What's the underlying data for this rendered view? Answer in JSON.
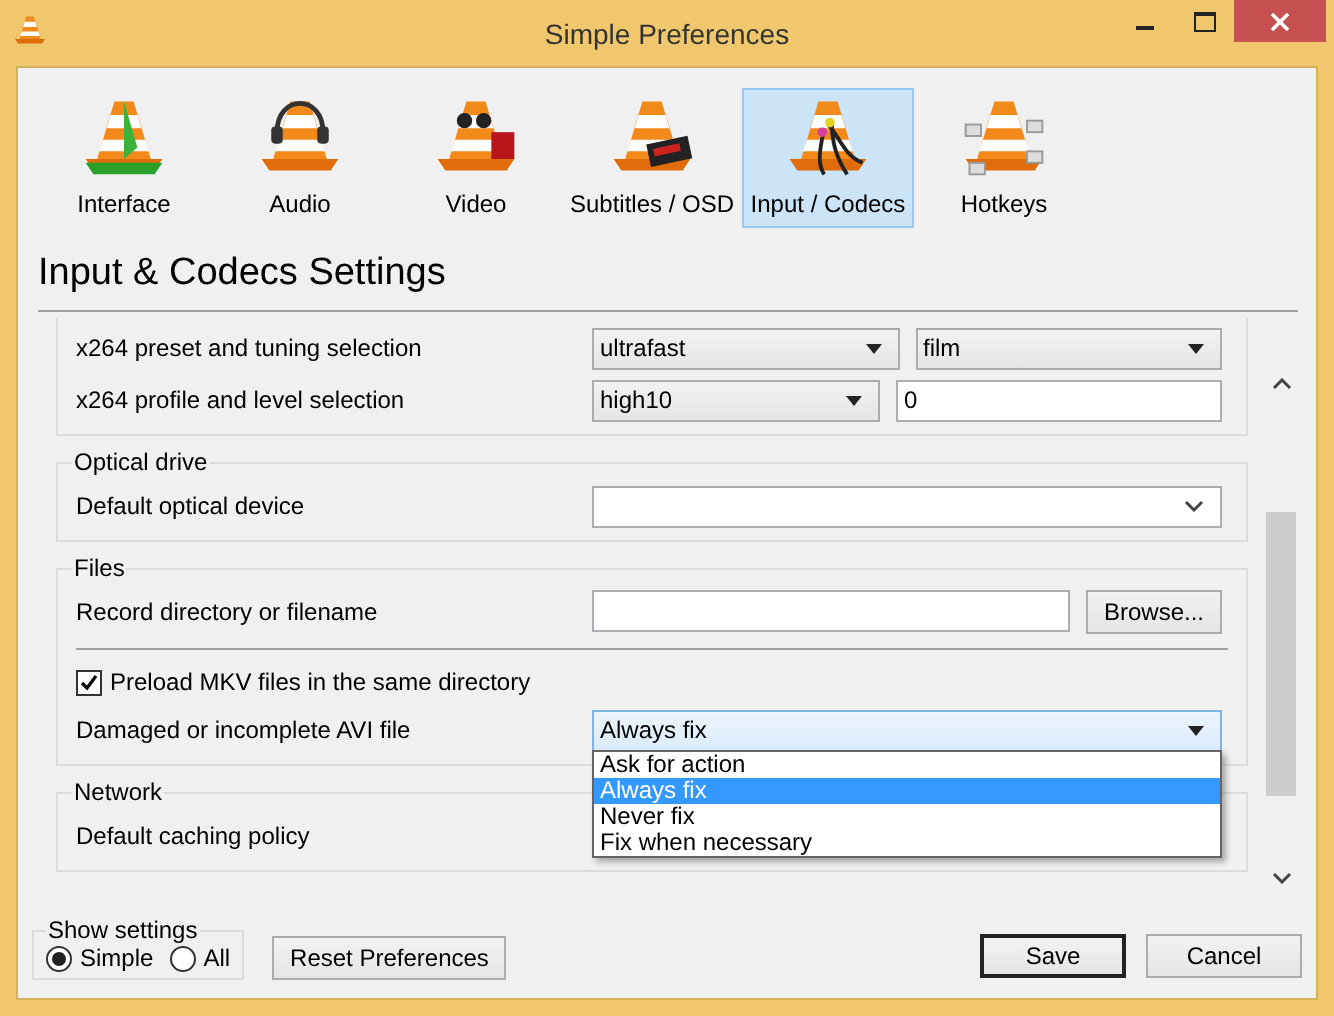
{
  "window": {
    "title": "Simple Preferences"
  },
  "tabs": [
    {
      "label": "Interface",
      "selected": false
    },
    {
      "label": "Audio",
      "selected": false
    },
    {
      "label": "Video",
      "selected": false
    },
    {
      "label": "Subtitles / OSD",
      "selected": false
    },
    {
      "label": "Input / Codecs",
      "selected": true
    },
    {
      "label": "Hotkeys",
      "selected": false
    }
  ],
  "heading": "Input & Codecs Settings",
  "sections": [
    {
      "rows": [
        {
          "kind": "combo_pair",
          "label": "x264 preset and tuning selection",
          "values": [
            "ultrafast",
            "film"
          ]
        },
        {
          "kind": "combo_field",
          "label": "x264 profile and level selection",
          "value": "high10",
          "field": "0"
        }
      ]
    },
    {
      "title": "Optical drive",
      "rows": [
        {
          "kind": "combo",
          "label": "Default optical device",
          "editable": true
        }
      ]
    },
    {
      "title": "Files",
      "rows": [
        {
          "kind": "field_button",
          "label": "Record directory or filename",
          "button": "Browse..."
        },
        {
          "kind": "separator"
        },
        {
          "kind": "checkbox",
          "label": "Preload MKV files in the same directory",
          "checked": true
        },
        {
          "kind": "combo",
          "label": "Damaged or incomplete AVI file",
          "value": "Always fix",
          "expanded": true,
          "options": [
            {
              "label": "Ask for action",
              "selected": false
            },
            {
              "label": "Always fix",
              "selected": true
            },
            {
              "label": "Never fix",
              "selected": false
            },
            {
              "label": "Fix when necessary",
              "selected": false
            }
          ]
        }
      ]
    },
    {
      "title": "Network",
      "rows": [
        {
          "kind": "combo",
          "label": "Default caching policy"
        }
      ]
    }
  ],
  "show_settings": {
    "title": "Show settings",
    "options": [
      {
        "label": "Simple",
        "selected": true
      },
      {
        "label": "All",
        "selected": false
      }
    ]
  },
  "buttons": {
    "reset": "Reset Preferences",
    "save": "Save",
    "cancel": "Cancel"
  }
}
